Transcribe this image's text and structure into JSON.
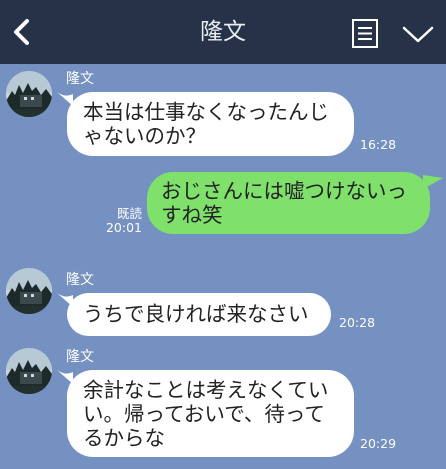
{
  "header": {
    "title": "隆文",
    "back_icon": "chevron-left-icon",
    "menu_icon": "list-icon",
    "expand_icon": "chevron-down-icon"
  },
  "messages": [
    {
      "sender": "隆文",
      "text": "本当は仕事なくなったんじゃないのか？",
      "time": "16:28",
      "side": "left"
    },
    {
      "sender": "",
      "text": "おじさんには嘘つけないっすね笑",
      "read": "既読",
      "time": "20:01",
      "side": "right"
    },
    {
      "sender": "隆文",
      "text": "うちで良ければ来なさい",
      "time": "20:28",
      "side": "left"
    },
    {
      "sender": "隆文",
      "text": "余計なことは考えなくていい。帰っておいで、待ってるからな",
      "time": "20:29",
      "side": "left"
    }
  ],
  "colors": {
    "background": "#7591c2",
    "header": "#263247",
    "bubble_left": "#ffffff",
    "bubble_right": "#7fe06c"
  }
}
